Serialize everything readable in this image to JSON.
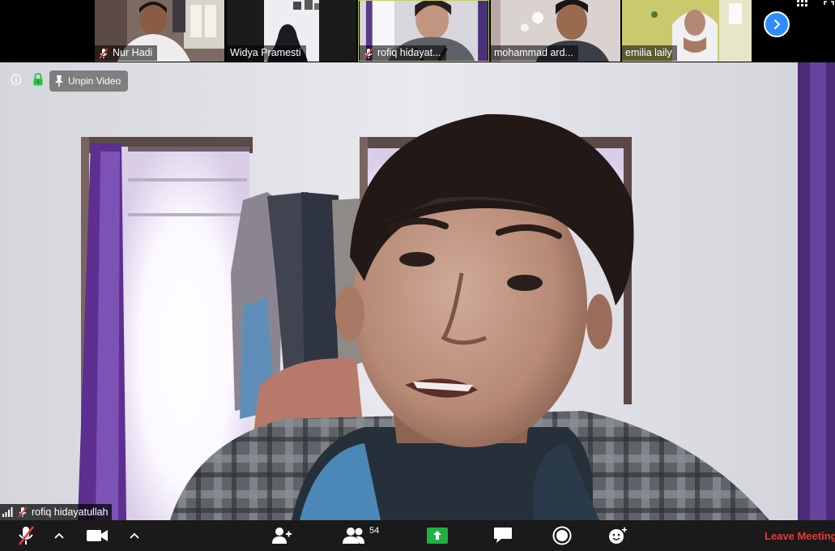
{
  "participants": [
    {
      "name": "Nur Hadi",
      "muted": true
    },
    {
      "name": "Widya Pramesti",
      "muted": false
    },
    {
      "name": "rofiq hidayat...",
      "muted": true,
      "active": true
    },
    {
      "name": "mohammad ard...",
      "muted": false
    },
    {
      "name": "emilia laily",
      "muted": false
    }
  ],
  "main_video": {
    "unpin_label": "Unpin Video",
    "speaker_name": "rofiq hidayatullah"
  },
  "toolbar": {
    "participants_count": "54",
    "leave_label": "Leave Meeting"
  },
  "colors": {
    "accent": "#2d8cff",
    "share_green": "#1fb141",
    "leave_red": "#e53a3a",
    "active_border": "#c2d16a"
  }
}
